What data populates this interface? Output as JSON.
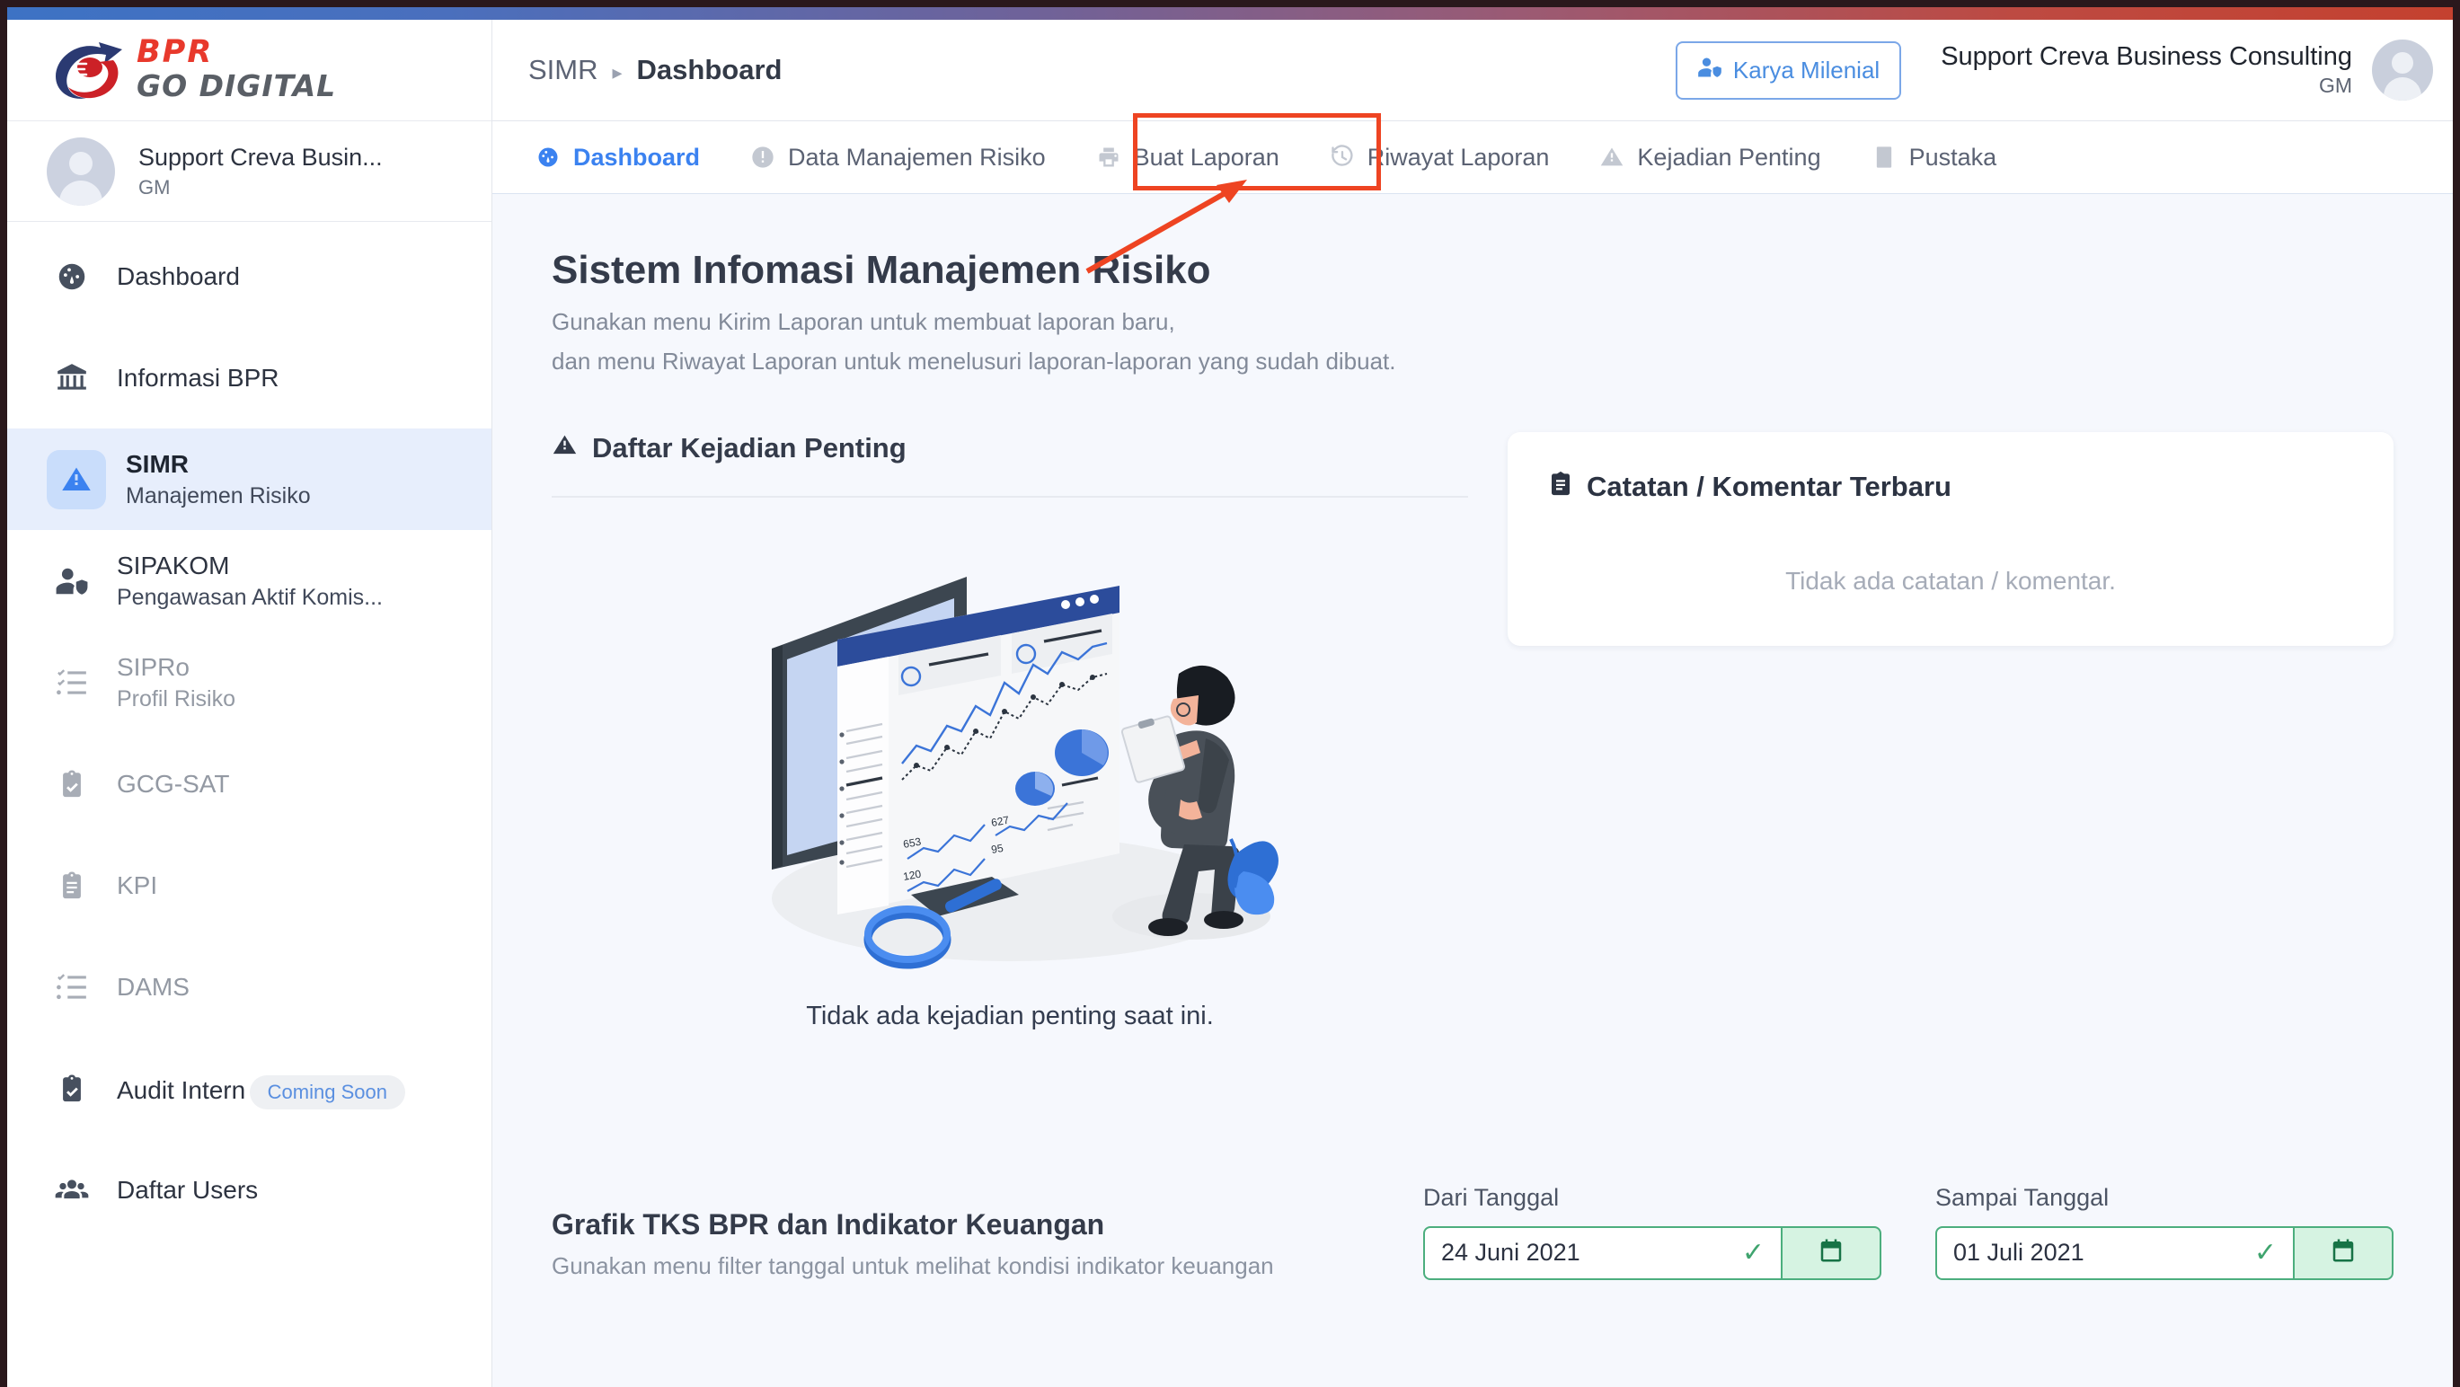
{
  "brand": {
    "bpr": "BPR",
    "go_digital": "GO DIGITAL",
    "accent_red": "#e8392c",
    "accent_blue": "#3b82f0"
  },
  "sidebar": {
    "user": {
      "name": "Support Creva Busin...",
      "role": "GM"
    },
    "items": [
      {
        "label": "Dashboard",
        "sub": "",
        "icon": "gauge-icon",
        "state": "normal"
      },
      {
        "label": "Informasi BPR",
        "sub": "",
        "icon": "bank-icon",
        "state": "normal"
      },
      {
        "label": "SIMR",
        "sub": "Manajemen Risiko",
        "icon": "warning-triangle-icon",
        "state": "active"
      },
      {
        "label": "SIPAKOM",
        "sub": "Pengawasan Aktif Komis...",
        "icon": "user-shield-icon",
        "state": "normal"
      },
      {
        "label": "SIPRo",
        "sub": "Profil Risiko",
        "icon": "checklist-icon",
        "state": "disabled"
      },
      {
        "label": "GCG-SAT",
        "sub": "",
        "icon": "clipboard-check-icon",
        "state": "disabled"
      },
      {
        "label": "KPI",
        "sub": "",
        "icon": "clipboard-list-icon",
        "state": "disabled"
      },
      {
        "label": "DAMS",
        "sub": "",
        "icon": "checklist-icon",
        "state": "disabled"
      },
      {
        "label": "Audit Intern",
        "sub": "",
        "badge": "Coming Soon",
        "icon": "clipboard-check-icon",
        "state": "normal"
      },
      {
        "label": "Daftar Users",
        "sub": "",
        "icon": "users-icon",
        "state": "normal"
      }
    ]
  },
  "header": {
    "breadcrumb_parent": "SIMR",
    "breadcrumb_current": "Dashboard",
    "karya_button": "Karya Milenial",
    "account_name": "Support Creva Business Consulting",
    "account_role": "GM"
  },
  "tabs": [
    {
      "label": "Dashboard",
      "icon": "gauge-icon",
      "active": true
    },
    {
      "label": "Data Manajemen Risiko",
      "icon": "info-circle-icon",
      "active": false
    },
    {
      "label": "Buat Laporan",
      "icon": "printer-icon",
      "active": false,
      "highlighted": true
    },
    {
      "label": "Riwayat Laporan",
      "icon": "history-icon",
      "active": false
    },
    {
      "label": "Kejadian Penting",
      "icon": "warning-triangle-icon",
      "active": false
    },
    {
      "label": "Pustaka",
      "icon": "book-icon",
      "active": false
    }
  ],
  "main": {
    "title": "Sistem Infomasi Manajemen Risiko",
    "subtitle_line1": "Gunakan menu Kirim Laporan untuk membuat laporan baru,",
    "subtitle_line2": "dan menu Riwayat Laporan untuk menelusuri laporan-laporan yang sudah dibuat.",
    "events_section_title": "Daftar Kejadian Penting",
    "events_empty": "Tidak ada kejadian penting saat ini.",
    "notes_card_title": "Catatan / Komentar Terbaru",
    "notes_empty": "Tidak ada catatan / komentar.",
    "chart_section_title": "Grafik TKS BPR dan Indikator Keuangan",
    "chart_section_sub": "Gunakan menu filter tanggal untuk melihat kondisi indikator keuangan",
    "date_from_label": "Dari Tanggal",
    "date_from_value": "24 Juni 2021",
    "date_to_label": "Sampai Tanggal",
    "date_to_value": "01 Juli 2021"
  },
  "annotation": {
    "color": "#ee4422",
    "target_tab": "Buat Laporan"
  }
}
